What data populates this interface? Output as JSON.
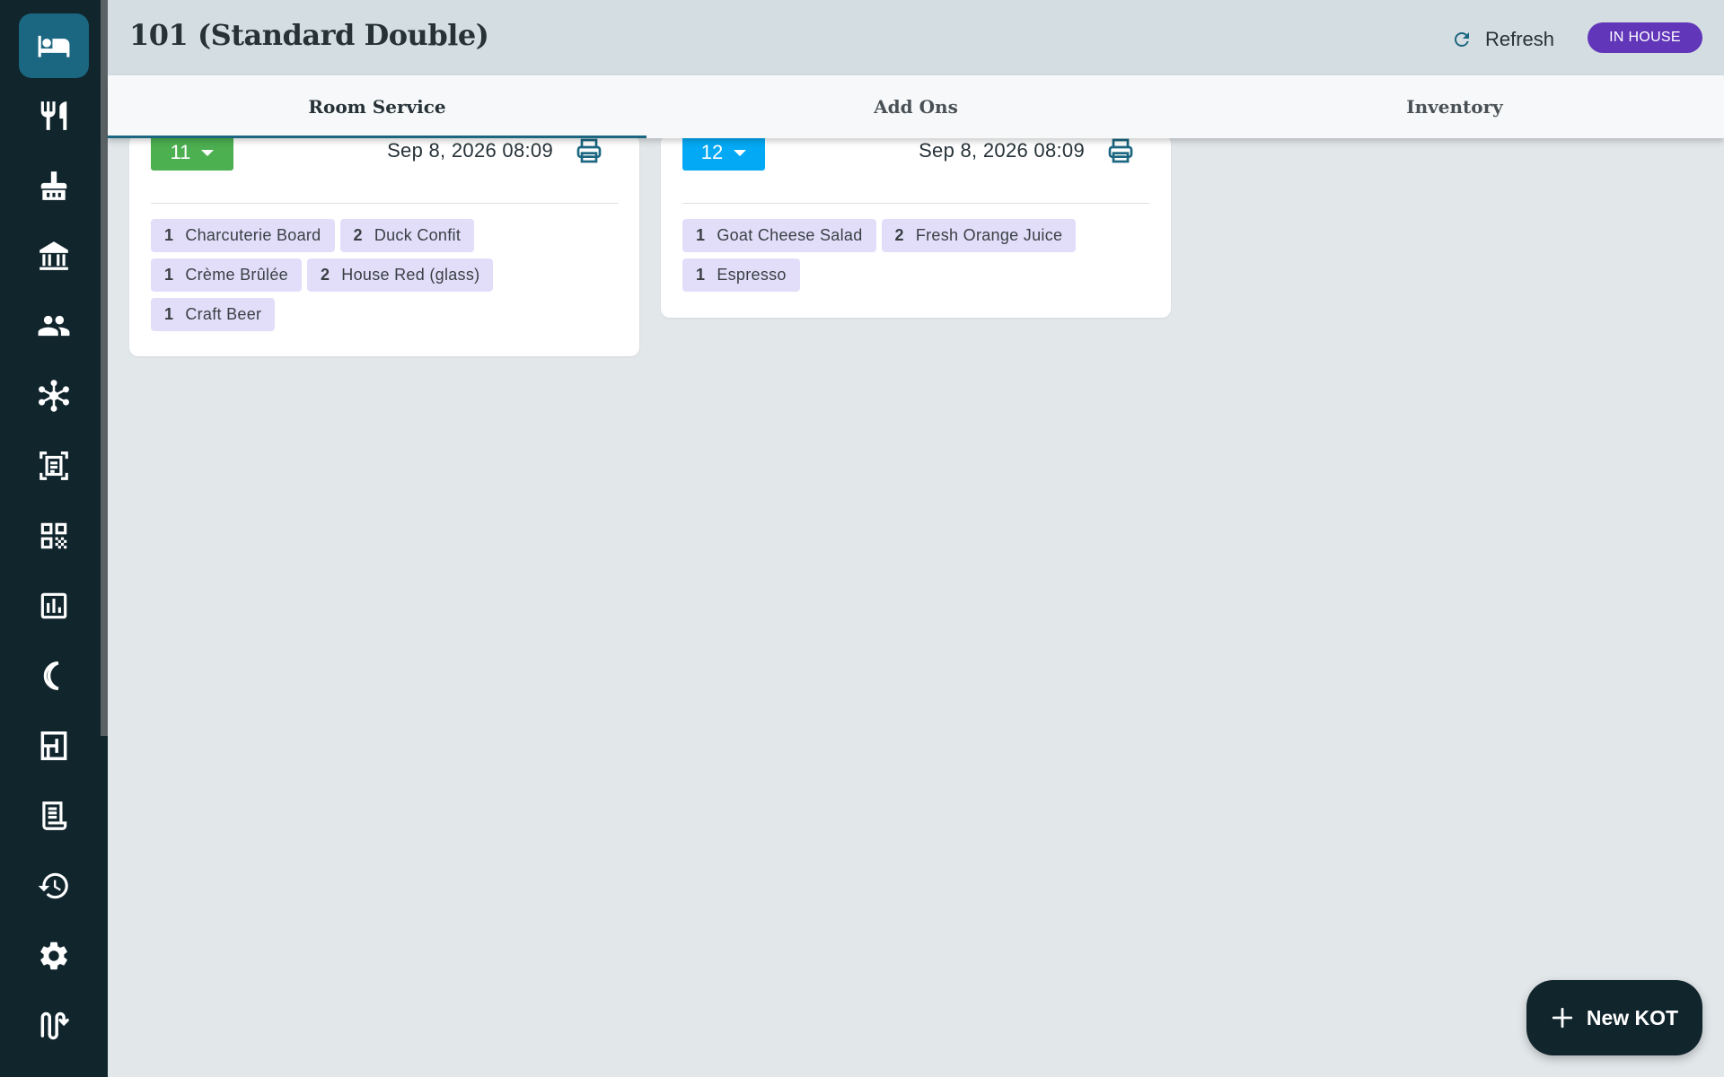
{
  "header": {
    "title": "101 (Standard Double)",
    "refresh_label": "Refresh",
    "status": "IN HOUSE"
  },
  "sidebar": {
    "items": [
      {
        "icon": "bed-icon",
        "active": true
      },
      {
        "icon": "restaurant-icon"
      },
      {
        "icon": "housekeeping-icon"
      },
      {
        "icon": "property-icon"
      },
      {
        "icon": "guests-icon"
      },
      {
        "icon": "network-icon"
      },
      {
        "icon": "scan-document-icon"
      },
      {
        "icon": "qr-code-icon"
      },
      {
        "icon": "reports-icon"
      },
      {
        "icon": "night-audit-icon"
      },
      {
        "icon": "floor-plan-icon"
      },
      {
        "icon": "invoice-icon"
      },
      {
        "icon": "history-icon"
      },
      {
        "icon": "settings-icon"
      },
      {
        "icon": "logout-icon"
      }
    ]
  },
  "tabs": [
    {
      "label": "Room Service",
      "active": true
    },
    {
      "label": "Add Ons"
    },
    {
      "label": "Inventory"
    }
  ],
  "kots": [
    {
      "number": "11",
      "color": "#4caf50",
      "time": "Sep 8, 2026 08:09",
      "items": [
        {
          "qty": "1",
          "name": "Charcuterie Board"
        },
        {
          "qty": "2",
          "name": "Duck Confit"
        },
        {
          "qty": "1",
          "name": "Crème Brûlée"
        },
        {
          "qty": "2",
          "name": "House Red (glass)"
        },
        {
          "qty": "1",
          "name": "Craft Beer"
        }
      ]
    },
    {
      "number": "12",
      "color": "#03a9f4",
      "time": "Sep 8, 2026 08:09",
      "items": [
        {
          "qty": "1",
          "name": "Goat Cheese Salad"
        },
        {
          "qty": "2",
          "name": "Fresh Orange Juice"
        },
        {
          "qty": "1",
          "name": "Espresso"
        }
      ]
    }
  ],
  "fab": {
    "label": "New KOT"
  },
  "colors": {
    "accent": "#1b6680",
    "sidebar": "#11252d",
    "badge": "#6136b9",
    "item_chip": "#e2defa"
  }
}
